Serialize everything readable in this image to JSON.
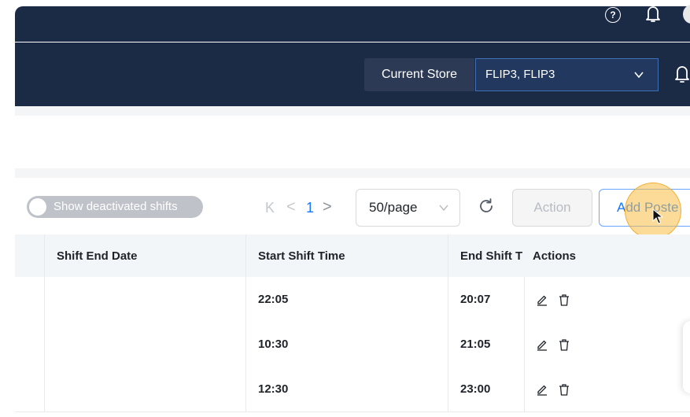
{
  "header": {
    "store_label": "Current Store",
    "store_value": "FLIP3, FLIP3",
    "help_symbol": "?"
  },
  "toolbar": {
    "toggle_label": "Show deactivated shifts",
    "toggle_checked": false,
    "pagination": {
      "first": "K",
      "prev": "<",
      "current": "1",
      "next": ">"
    },
    "page_size": "50/page",
    "action_label": "Action",
    "add_label": "Add Poste"
  },
  "table": {
    "headers": [
      "Shift End Date",
      "Start Shift Time",
      "End Shift T",
      "Actions"
    ],
    "rows": [
      {
        "end_date": "",
        "start_time": "22:05",
        "end_time": "20:07"
      },
      {
        "end_date": "",
        "start_time": "10:30",
        "end_time": "21:05"
      },
      {
        "end_date": "",
        "start_time": "12:30",
        "end_time": "23:00"
      }
    ]
  },
  "colors": {
    "header_bg": "#1b2a45",
    "accent": "#1677ff",
    "cursor_highlight": "#fabe46"
  }
}
